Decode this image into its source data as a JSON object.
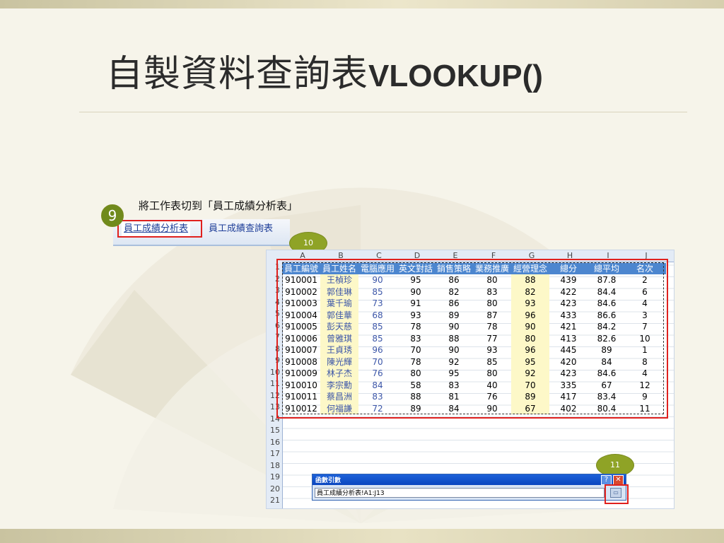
{
  "slide": {
    "title_cjk": "自製資料查詢表",
    "title_latin": "VLOOKUP()"
  },
  "instruction": "將工作表切到「員工成績分析表」",
  "tabs": [
    "員工成績分析表",
    "員工成績查詢表"
  ],
  "steps": {
    "s9": "9",
    "s10": "10",
    "s11": "11"
  },
  "sheet": {
    "columns": [
      "A",
      "B",
      "C",
      "D",
      "E",
      "F",
      "G",
      "H",
      "I",
      "J"
    ],
    "headers": [
      "員工編號",
      "員工姓名",
      "電腦應用",
      "英文對話",
      "銷售策略",
      "業務推廣",
      "經營理念",
      "總分",
      "總平均",
      "名次"
    ],
    "row_numbers": [
      "1",
      "2",
      "3",
      "4",
      "5",
      "6",
      "7",
      "8",
      "9",
      "10",
      "11",
      "12",
      "13",
      "14",
      "15",
      "16",
      "17",
      "18",
      "19",
      "20",
      "21"
    ],
    "rows": [
      [
        "910001",
        "王楨珍",
        "90",
        "95",
        "86",
        "80",
        "88",
        "439",
        "87.8",
        "2"
      ],
      [
        "910002",
        "郭佳琳",
        "85",
        "90",
        "82",
        "83",
        "82",
        "422",
        "84.4",
        "6"
      ],
      [
        "910003",
        "葉千瑜",
        "73",
        "91",
        "86",
        "80",
        "93",
        "423",
        "84.6",
        "4"
      ],
      [
        "910004",
        "郭佳華",
        "68",
        "93",
        "89",
        "87",
        "96",
        "433",
        "86.6",
        "3"
      ],
      [
        "910005",
        "彭天慈",
        "85",
        "78",
        "90",
        "78",
        "90",
        "421",
        "84.2",
        "7"
      ],
      [
        "910006",
        "曾雅琪",
        "85",
        "83",
        "88",
        "77",
        "80",
        "413",
        "82.6",
        "10"
      ],
      [
        "910007",
        "王貞琇",
        "96",
        "70",
        "90",
        "93",
        "96",
        "445",
        "89",
        "1"
      ],
      [
        "910008",
        "陳光輝",
        "70",
        "78",
        "92",
        "85",
        "95",
        "420",
        "84",
        "8"
      ],
      [
        "910009",
        "林子杰",
        "76",
        "80",
        "95",
        "80",
        "92",
        "423",
        "84.6",
        "4"
      ],
      [
        "910010",
        "李宗勳",
        "84",
        "58",
        "83",
        "40",
        "70",
        "335",
        "67",
        "12"
      ],
      [
        "910011",
        "蔡昌洲",
        "83",
        "88",
        "81",
        "76",
        "89",
        "417",
        "83.4",
        "9"
      ],
      [
        "910012",
        "何福謙",
        "72",
        "89",
        "84",
        "90",
        "67",
        "402",
        "80.4",
        "11"
      ]
    ]
  },
  "dialog": {
    "title": "函數引數",
    "help": "?",
    "close": "✕",
    "reference": "員工成績分析表!A1:J13"
  },
  "colors": {
    "accent_red": "#e0211e",
    "header_blue": "#4c86cf",
    "step_green": "#8fa326"
  }
}
